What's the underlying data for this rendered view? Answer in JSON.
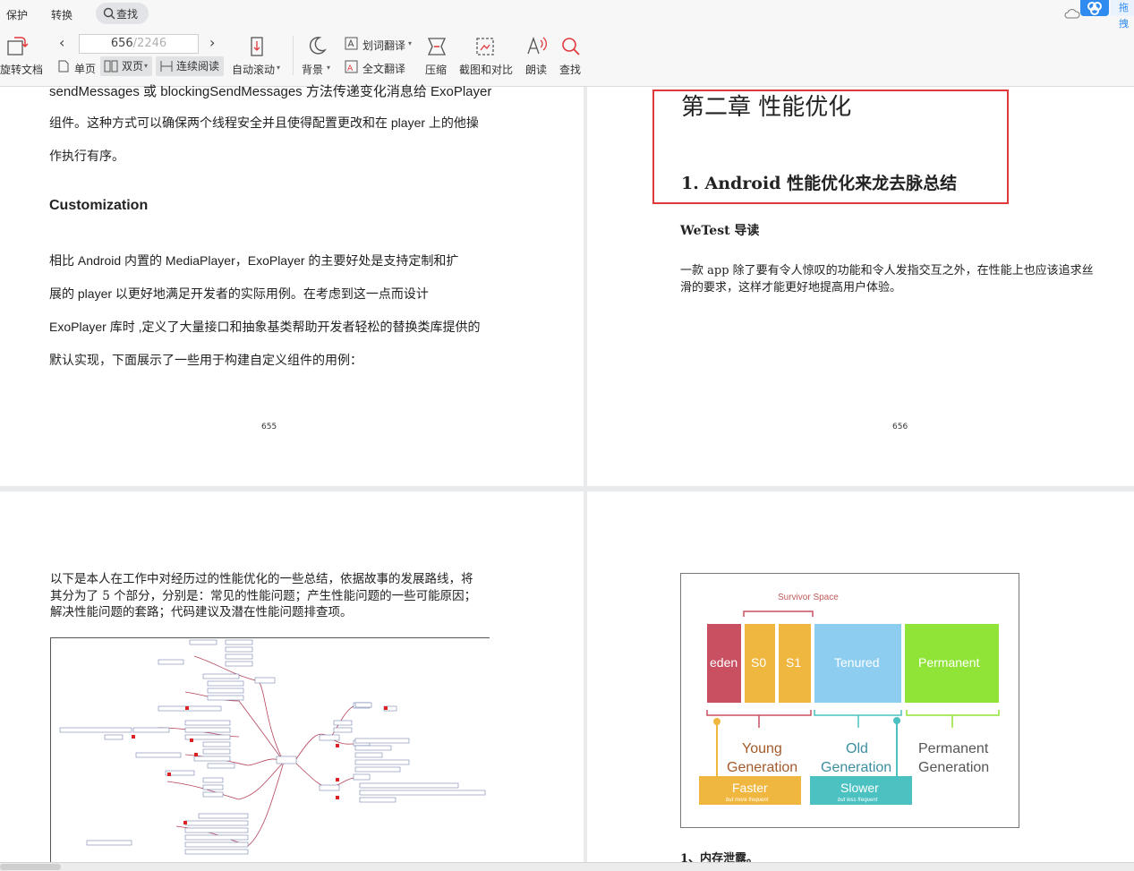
{
  "menu": {
    "protect": "保护",
    "convert": "转换",
    "find": "查找"
  },
  "toolbar": {
    "rotate_label": "旋转文档",
    "page_current": "656",
    "page_total": "/2246",
    "single": "单页",
    "double": "双页",
    "continuous": "连续阅读",
    "auto_scroll": "自动滚动",
    "background": "背景",
    "word_translate": "划词翻译",
    "full_translate": "全文翻译",
    "compress": "压缩",
    "screenshot_compare": "截图和对比",
    "read_aloud": "朗读",
    "find": "查找",
    "drag_tab": "拖拽"
  },
  "page655": {
    "line0": "sendMessages 或 blockingSendMessages 方法传递变化消息给 ExoPlayer",
    "line1": "组件。这种方式可以确保两个线程安全并且使得配置更改和在 player 上的他操",
    "line2": "作执行有序。",
    "heading": "Customization",
    "p1": "相比 Android 内置的 MediaPlayer，ExoPlayer 的主要好处是支持定制和扩",
    "p2": "展的 player 以更好地满足开发者的实际用例。在考虑到这一点而设计",
    "p3": "ExoPlayer 库时 ,定义了大量接口和抽象基类帮助开发者轻松的替换类库提供的",
    "p4": "默认实现，下面展示了一些用于构建自定义组件的用例：",
    "number": "655"
  },
  "page656": {
    "chapter": "第二章  性能优化",
    "section": "1. Android 性能优化来龙去脉总结",
    "wetest": "WeTest 导读",
    "intro1": "一款 app 除了要有令人惊叹的功能和令人发指交互之外，在性能上也应该追求丝",
    "intro2": "滑的要求，这样才能更好地提高用户体验。",
    "number": "656"
  },
  "page657": {
    "l1": "以下是本人在工作中对经历过的性能优化的一些总结，依据故事的发展路线，将",
    "l2": "其分为了 5 个部分，分别是：常见的性能问题；产生性能问题的一些可能原因；",
    "l3": "解决性能问题的套路；代码建议及潜在性能问题排查项。"
  },
  "page658": {
    "survivor": "Survivor Space",
    "eden": "eden",
    "s0": "S0",
    "s1": "S1",
    "tenured": "Tenured",
    "permanent": "Permanent",
    "young": "Young",
    "young2": "Generation",
    "old": "Old",
    "old2": "Generation",
    "perm": "Permanent",
    "perm2": "Generation",
    "faster": "Faster",
    "faster_sub": "but more frequent",
    "slower": "Slower",
    "slower_sub": "but less frequent",
    "leak": "1、内存泄露。"
  },
  "colors": {
    "eden": "#c95060",
    "survivor": "#f0b740",
    "tenured": "#8ccdf0",
    "permanent": "#90e437",
    "faster": "#f0b740",
    "slower": "#4cc1c1",
    "redbox": "#e0393b"
  }
}
